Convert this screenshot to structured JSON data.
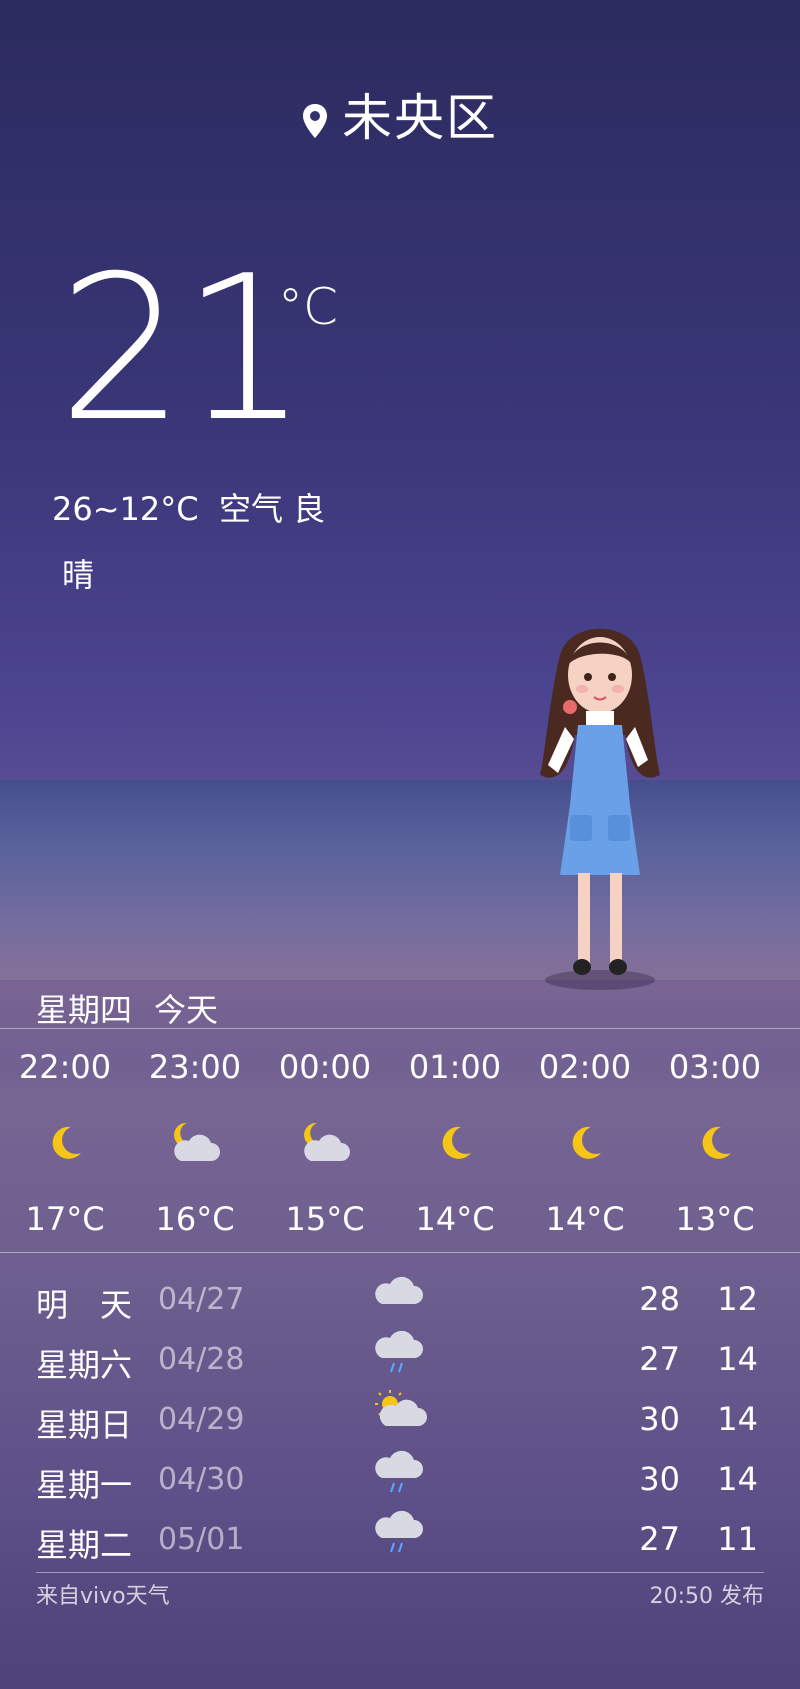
{
  "location": {
    "name": "未央区",
    "icon": "map-pin-icon"
  },
  "current": {
    "temp": "21",
    "unit": "°C",
    "range": "26~12°C",
    "air_label": "空气",
    "air_quality": "良",
    "condition": "晴"
  },
  "today": {
    "weekday": "星期四",
    "label": "今天"
  },
  "hourly": [
    {
      "time": "22:00",
      "icon": "moon-icon",
      "temp": "17°C"
    },
    {
      "time": "23:00",
      "icon": "moon-cloud-icon",
      "temp": "16°C"
    },
    {
      "time": "00:00",
      "icon": "moon-cloud-icon",
      "temp": "15°C"
    },
    {
      "time": "01:00",
      "icon": "moon-icon",
      "temp": "14°C"
    },
    {
      "time": "02:00",
      "icon": "moon-icon",
      "temp": "14°C"
    },
    {
      "time": "03:00",
      "icon": "moon-icon",
      "temp": "13°C"
    }
  ],
  "daily": [
    {
      "name": "明　天",
      "date": "04/27",
      "icon": "cloud-icon",
      "high": "28",
      "low": "12"
    },
    {
      "name": "星期六",
      "date": "04/28",
      "icon": "rain-cloud-icon",
      "high": "27",
      "low": "14"
    },
    {
      "name": "星期日",
      "date": "04/29",
      "icon": "sun-cloud-icon",
      "high": "30",
      "low": "14"
    },
    {
      "name": "星期一",
      "date": "04/30",
      "icon": "rain-cloud-icon",
      "high": "30",
      "low": "14"
    },
    {
      "name": "星期二",
      "date": "05/01",
      "icon": "rain-cloud-icon",
      "high": "27",
      "low": "11"
    }
  ],
  "footer": {
    "source": "来自vivo天气",
    "published": "20:50 发布"
  },
  "colors": {
    "moon": "#f5c518",
    "cloud": "#d9d9e3",
    "rain": "#5aa8ff"
  }
}
